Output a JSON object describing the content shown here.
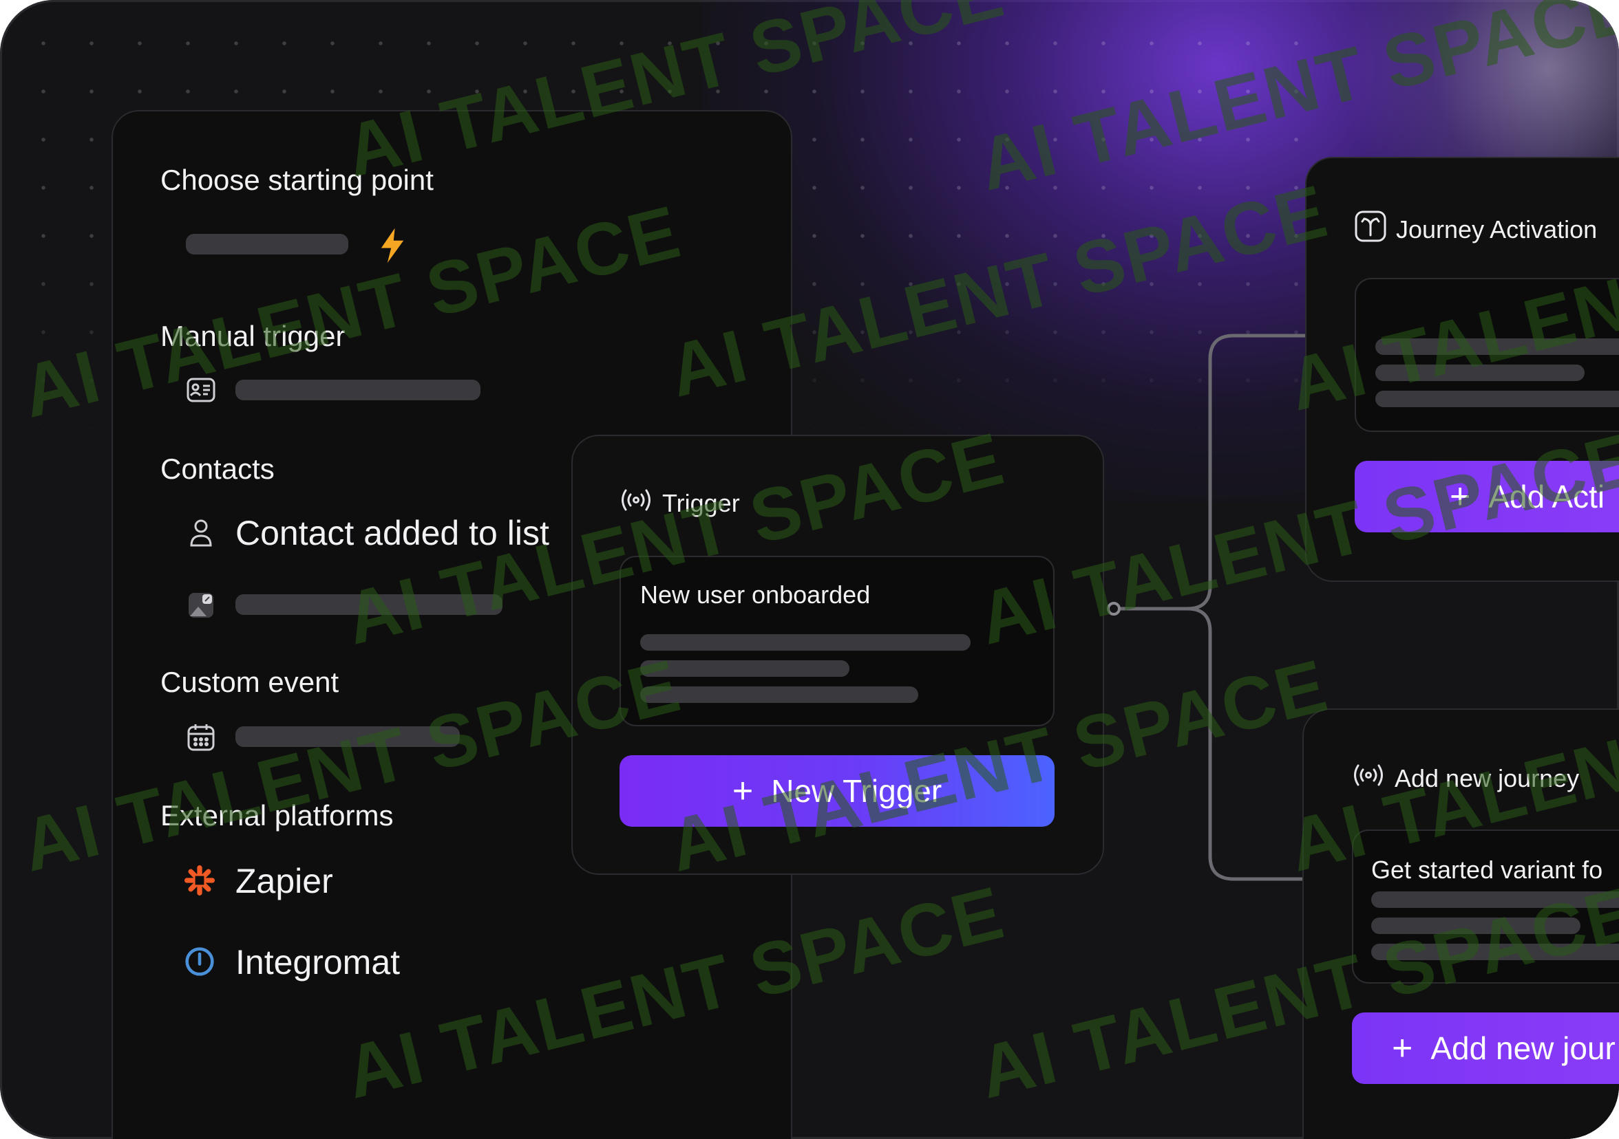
{
  "left_panel": {
    "sections": [
      {
        "title": "Choose starting point"
      },
      {
        "title": "Manual trigger"
      },
      {
        "title": "Contacts"
      },
      {
        "title": "Custom event"
      },
      {
        "title": "External platforms"
      }
    ],
    "contacts_item": {
      "label": "Contact added to list",
      "icon": "person-icon"
    },
    "platforms": [
      {
        "label": "Zapier",
        "icon": "zapier-icon",
        "color": "#f15a24"
      },
      {
        "label": "Integromat",
        "icon": "integromat-icon",
        "color": "#4a90d9"
      }
    ]
  },
  "trigger_card": {
    "header": "Trigger",
    "inner_title": "New user onboarded",
    "button_label": "New Trigger",
    "button_plus": "+"
  },
  "journey_activation_card": {
    "header": "Journey Activation",
    "button_label": "Add Acti",
    "button_plus": "+"
  },
  "add_journey_card": {
    "header": "Add new journey",
    "inner_title": "Get started variant fo",
    "button_label": "Add new jour",
    "button_plus": "+"
  },
  "watermark": "AI TALENT SPACE",
  "colors": {
    "background": "#141416",
    "panel": "#0e0e0f",
    "accent_purple": "#7c34f6",
    "accent_blue": "#4b63ff",
    "lightning": "#f5a623"
  }
}
